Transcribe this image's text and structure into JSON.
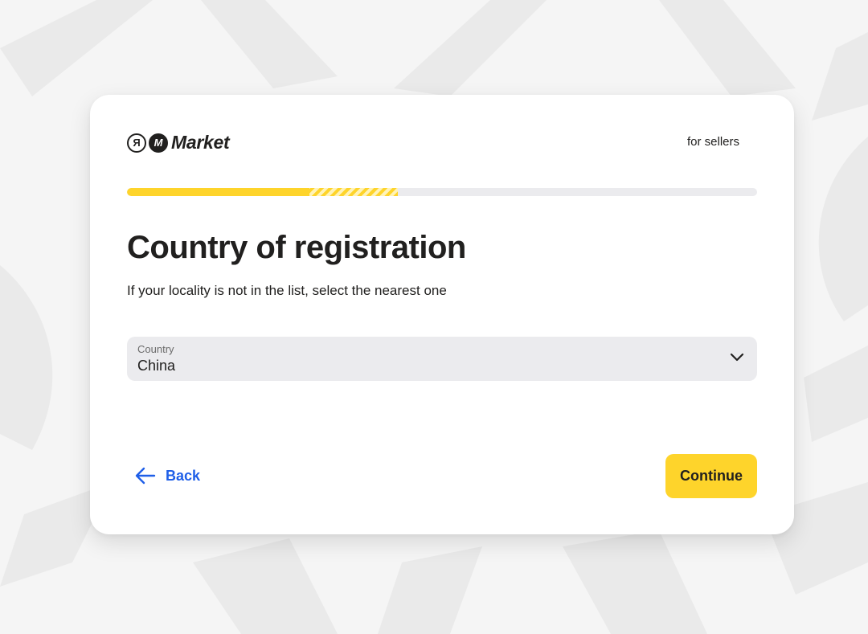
{
  "brand": {
    "logo_letter_1": "Я",
    "logo_letter_2": "M",
    "name": "Market",
    "tagline": "for sellers"
  },
  "progress": {
    "fraction": 0.43,
    "striped_segment_end": 0.43
  },
  "page": {
    "title": "Country of registration",
    "subtitle": "If your locality is not in the list, select the nearest one"
  },
  "country_select": {
    "label": "Country",
    "value": "China"
  },
  "footer": {
    "back_label": "Back",
    "continue_label": "Continue"
  },
  "colors": {
    "accent_yellow": "#fed42b",
    "link_blue": "#1f5fe8",
    "text": "#21201f",
    "field_bg": "#ebebee"
  },
  "icons": {
    "back": "arrow-left-icon",
    "dropdown": "chevron-down-icon"
  }
}
